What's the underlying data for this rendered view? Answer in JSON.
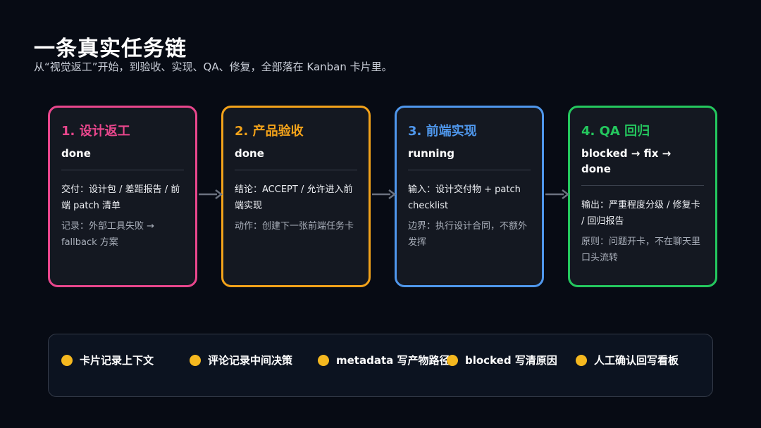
{
  "header": {
    "title": "一条真实任务链",
    "subtitle": "从“视觉返工”开始，到验收、实现、QA、修复，全部落在 Kanban 卡片里。"
  },
  "cards": [
    {
      "title": "1. 设计返工",
      "status": "done",
      "main": "交付：设计包 / 差距报告 / 前端 patch 清单",
      "note": "记录：外部工具失败 → fallback 方案",
      "color": "#e8468c"
    },
    {
      "title": "2. 产品验收",
      "status": "done",
      "main": "结论：ACCEPT / 允许进入前端实现",
      "note": "动作：创建下一张前端任务卡",
      "color": "#f2a21a"
    },
    {
      "title": "3. 前端实现",
      "status": "running",
      "main": "输入：设计交付物 + patch checklist",
      "note": "边界：执行设计合同，不额外发挥",
      "color": "#4f97ec"
    },
    {
      "title": "4. QA 回归",
      "status": "blocked → fix → done",
      "main": "输出：严重程度分级 / 修复卡 / 回归报告",
      "note": "原则：问题开卡，不在聊天里口头流转",
      "color": "#24c75e"
    }
  ],
  "legend": {
    "dot_color": "#f5b81f",
    "items": [
      "卡片记录上下文",
      "评论记录中间决策",
      "metadata 写产物路径",
      "blocked 写清原因",
      "人工确认回写看板"
    ]
  },
  "arrow_color": "#6b7280"
}
